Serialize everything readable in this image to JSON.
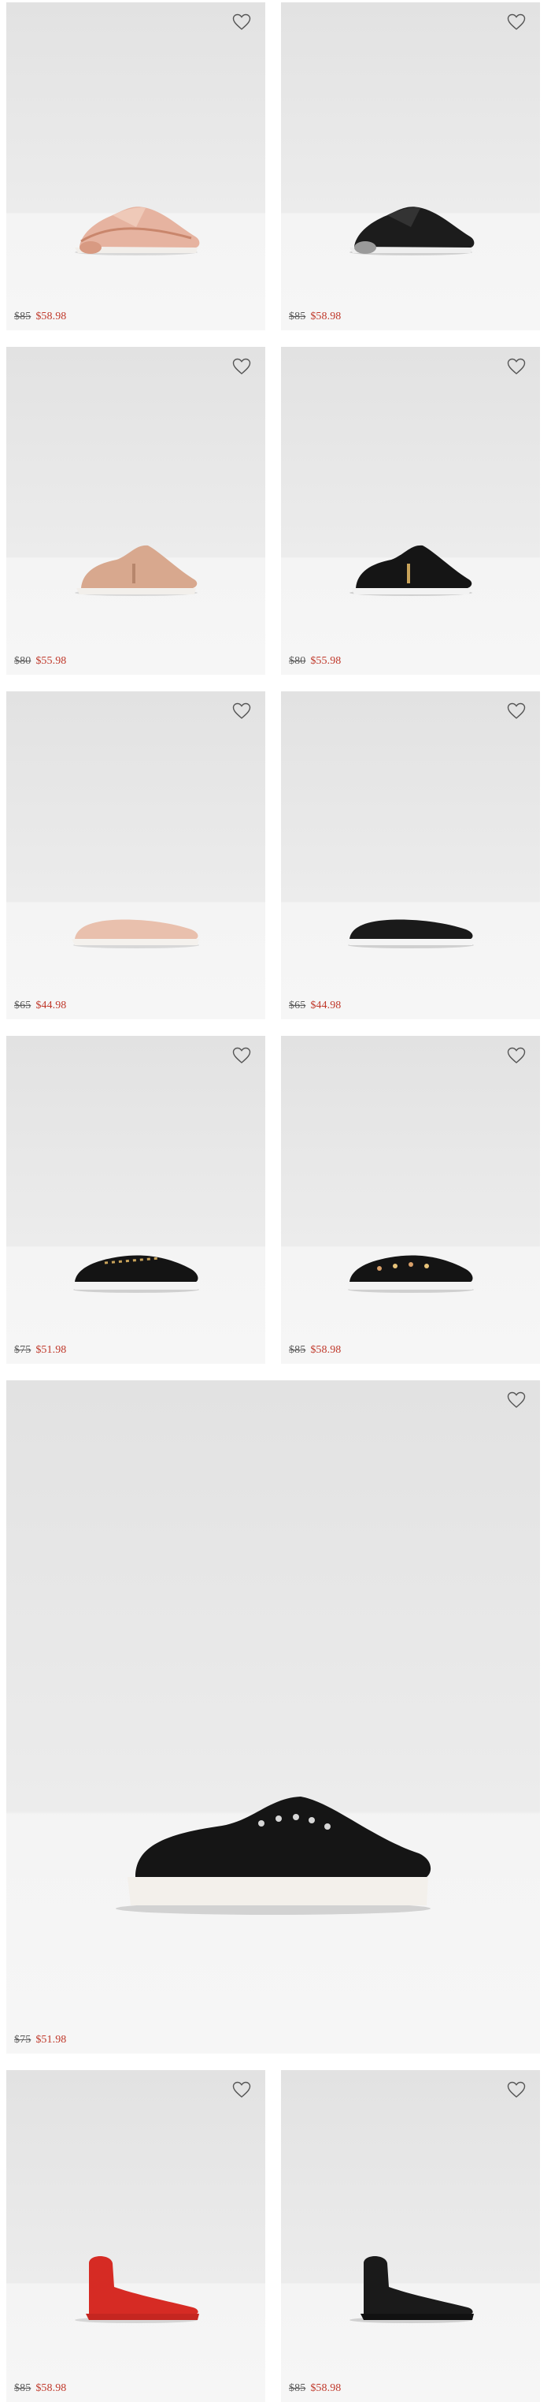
{
  "colors": {
    "sale": "#c0392b",
    "original": "#5a5a5a",
    "card_bg": "#e4e4e4"
  },
  "products": [
    {
      "name": "rose-gold-air-sneaker",
      "original_price": "$85",
      "sale_price": "$58.98"
    },
    {
      "name": "black-air-sneaker",
      "original_price": "$85",
      "sale_price": "$58.98"
    },
    {
      "name": "blush-zip-sneaker",
      "original_price": "$80",
      "sale_price": "$55.98"
    },
    {
      "name": "black-zip-sneaker",
      "original_price": "$80",
      "sale_price": "$55.98"
    },
    {
      "name": "blush-quilted-slip-on",
      "original_price": "$65",
      "sale_price": "$44.98"
    },
    {
      "name": "black-quilted-slip-on",
      "original_price": "$65",
      "sale_price": "$44.98"
    },
    {
      "name": "black-lace-up-sneaker",
      "original_price": "$75",
      "sale_price": "$51.98"
    },
    {
      "name": "black-embellished-slip-on",
      "original_price": "$85",
      "sale_price": "$58.98"
    },
    {
      "name": "black-platform-sneaker-featured",
      "original_price": "$75",
      "sale_price": "$51.98"
    },
    {
      "name": "red-sock-sneaker",
      "original_price": "$85",
      "sale_price": "$58.98"
    },
    {
      "name": "black-sock-sneaker",
      "original_price": "$85",
      "sale_price": "$58.98"
    }
  ],
  "icons": {
    "wishlist": "heart-outline-icon"
  }
}
